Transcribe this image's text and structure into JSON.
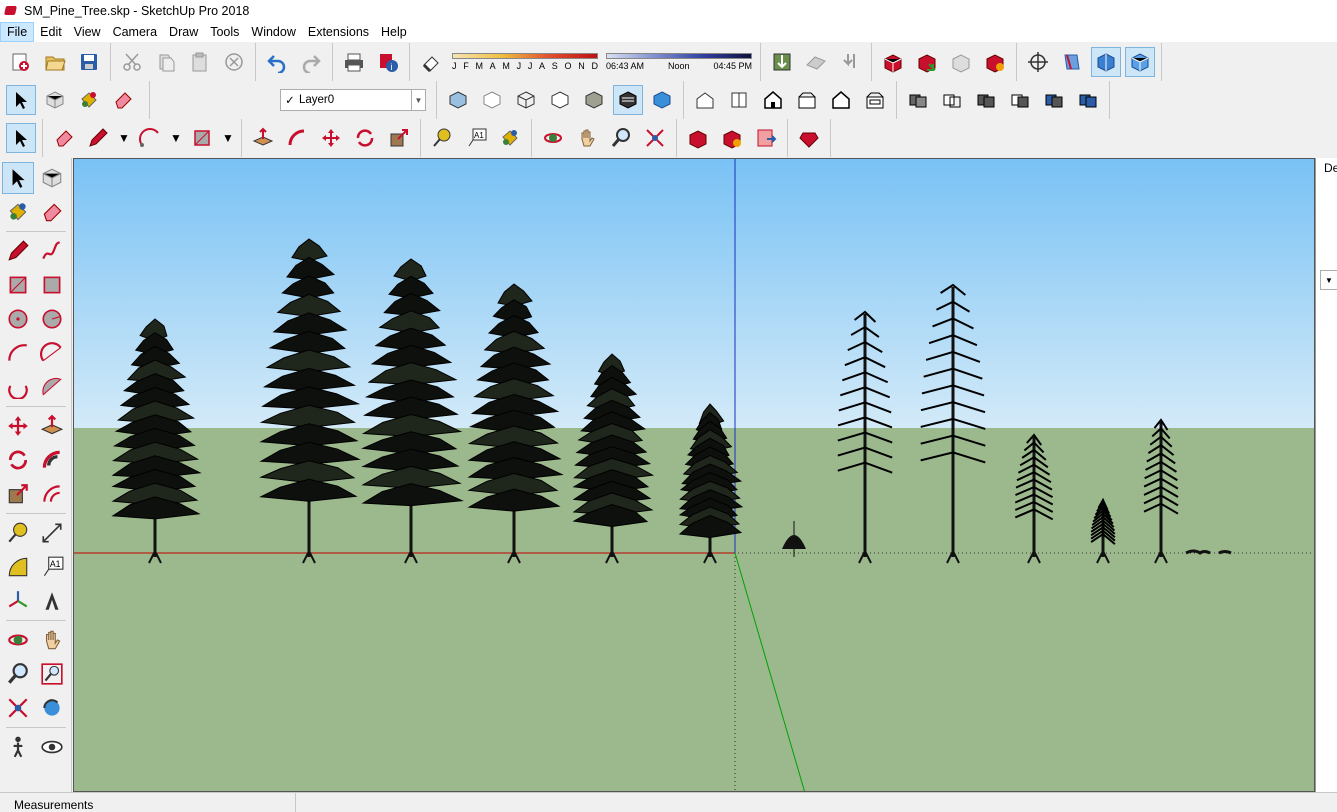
{
  "window": {
    "title": "SM_Pine_Tree.skp - SketchUp Pro 2018"
  },
  "menu": {
    "items": [
      "File",
      "Edit",
      "View",
      "Camera",
      "Draw",
      "Tools",
      "Window",
      "Extensions",
      "Help"
    ],
    "active": "File"
  },
  "shadows": {
    "months": [
      "J",
      "F",
      "M",
      "A",
      "M",
      "J",
      "J",
      "A",
      "S",
      "O",
      "N",
      "D"
    ],
    "time_start": "06:43 AM",
    "time_mid": "Noon",
    "time_end": "04:45 PM"
  },
  "layers": {
    "current": "Layer0",
    "check": "✓"
  },
  "tray": {
    "label": "De",
    "arrow": "▼"
  },
  "status": {
    "text": "Measurements"
  },
  "colors": {
    "sky_top": "#79c2f5",
    "sky_bottom": "#d3eaf8",
    "ground": "#9cb98d",
    "red_axis": "#c00000",
    "green_axis": "#00a000",
    "blue_axis": "#1830c0"
  },
  "icons": [
    "select-icon",
    "component-icon",
    "paint-bucket-icon",
    "eraser-icon",
    "pencil-icon",
    "arc-icon",
    "rectangle-icon",
    "push-pull-icon",
    "follow-me-icon",
    "move-icon",
    "rotate-icon",
    "scale-icon",
    "tape-measure-icon",
    "text-icon",
    "orbit-icon",
    "pan-icon",
    "zoom-icon",
    "zoom-extents-icon"
  ]
}
